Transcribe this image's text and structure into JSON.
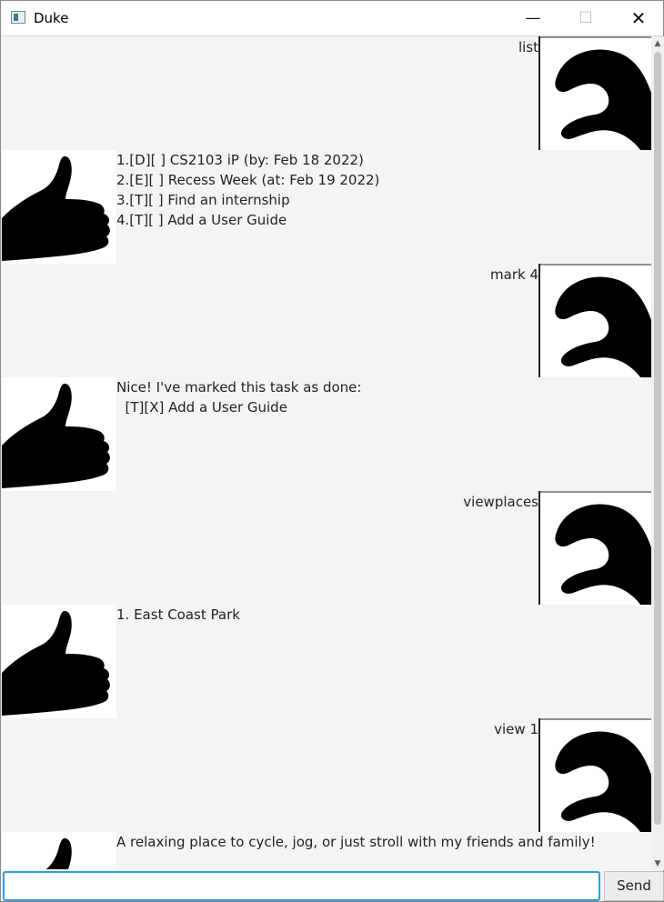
{
  "window": {
    "title": "Duke",
    "minimize": "—",
    "maximize": "☐",
    "close": "✕"
  },
  "messages": [
    {
      "sender": "user",
      "text": "list"
    },
    {
      "sender": "duke",
      "text": "1.[D][ ] CS2103 iP (by: Feb 18 2022)\n2.[E][ ] Recess Week (at: Feb 19 2022)\n3.[T][ ] Find an internship\n4.[T][ ] Add a User Guide"
    },
    {
      "sender": "user",
      "text": "mark 4"
    },
    {
      "sender": "duke",
      "text": "Nice! I've marked this task as done:\n  [T][X] Add a User Guide"
    },
    {
      "sender": "user",
      "text": "viewplaces"
    },
    {
      "sender": "duke",
      "text": "1. East Coast Park"
    },
    {
      "sender": "user",
      "text": "view 1"
    },
    {
      "sender": "duke",
      "text": "A relaxing place to cycle, jog, or just stroll with my friends and family!"
    }
  ],
  "input": {
    "value": "",
    "placeholder": ""
  },
  "send_label": "Send",
  "icons": {
    "user_avatar": "hand-claw-icon",
    "duke_avatar": "thumbs-up-icon"
  },
  "colors": {
    "input_focus": "#2c9fdc",
    "background": "#f4f4f4"
  }
}
